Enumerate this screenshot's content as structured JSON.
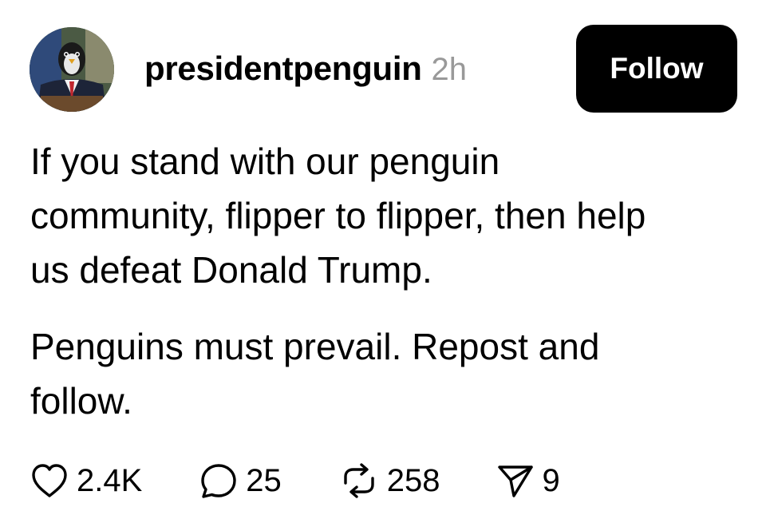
{
  "post": {
    "author": {
      "username": "presidentpenguin",
      "timestamp": "2h",
      "avatar_icon": "penguin-in-suit-avatar"
    },
    "follow_button_label": "Follow",
    "paragraphs": [
      "If you stand with our penguin\ncommunity, flipper to flipper, then help\nus defeat Donald Trump.",
      "Penguins must prevail. Repost and\nfollow."
    ],
    "actions": {
      "like": {
        "icon": "heart-icon",
        "count": "2.4K"
      },
      "reply": {
        "icon": "speech-bubble-icon",
        "count": "25"
      },
      "repost": {
        "icon": "repost-icon",
        "count": "258"
      },
      "share": {
        "icon": "send-icon",
        "count": "9"
      }
    },
    "colors": {
      "text": "#000000",
      "muted": "#999999",
      "button_bg": "#000000",
      "button_text": "#ffffff",
      "background": "#ffffff"
    }
  }
}
